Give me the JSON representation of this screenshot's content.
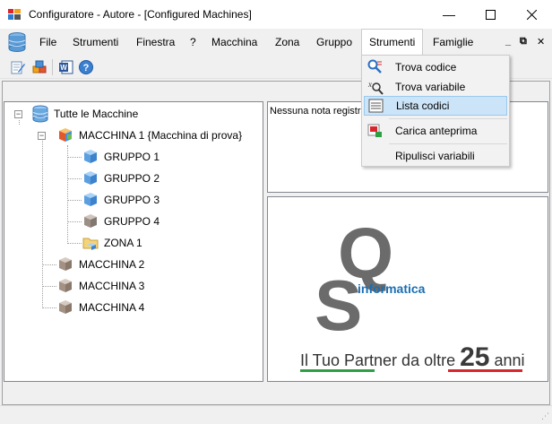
{
  "window": {
    "title": "Configuratore - Autore - [Configured Machines]",
    "controls": [
      "minimize",
      "maximize",
      "close"
    ]
  },
  "menubar": {
    "items": [
      {
        "label": "File"
      },
      {
        "label": "Strumenti"
      },
      {
        "label": "Finestra"
      },
      {
        "label": "?"
      },
      {
        "label": "Macchina"
      },
      {
        "label": "Zona"
      },
      {
        "label": "Gruppo"
      },
      {
        "label": "Strumenti",
        "active": true
      },
      {
        "label": "Famiglie"
      }
    ],
    "mdi_controls": [
      "_",
      "⧉",
      "✕"
    ]
  },
  "toolbar": {
    "icons": [
      "edit-icon",
      "boxes-icon",
      "word-icon",
      "help-icon"
    ]
  },
  "dropdown": {
    "items": [
      {
        "label": "Trova codice",
        "icon": "find-code-icon"
      },
      {
        "label": "Trova variabile",
        "icon": "find-variable-icon"
      },
      {
        "label": "Lista codici",
        "icon": "list-icon",
        "selected": true
      },
      {
        "label": "Carica anteprima",
        "icon": "load-preview-icon"
      },
      {
        "label": "Ripulisci variabili",
        "icon": ""
      }
    ]
  },
  "tree": {
    "root": "Tutte le Macchine",
    "nodes": [
      {
        "label": "MACCHINA 1 {Macchina di prova}",
        "icon": "machine-colored-icon"
      },
      {
        "label": "GRUPPO 1",
        "icon": "group-blue-icon"
      },
      {
        "label": "GRUPPO 2",
        "icon": "group-blue-icon"
      },
      {
        "label": "GRUPPO 3",
        "icon": "group-blue-icon"
      },
      {
        "label": "GRUPPO 4",
        "icon": "group-gray-icon"
      },
      {
        "label": "ZONA 1",
        "icon": "folder-zone-icon"
      },
      {
        "label": "MACCHINA 2",
        "icon": "machine-gray-icon"
      },
      {
        "label": "MACCHINA 3",
        "icon": "machine-gray-icon"
      },
      {
        "label": "MACCHINA 4",
        "icon": "machine-gray-icon"
      }
    ]
  },
  "notes": {
    "text": "Nessuna nota registra… tive alla macchina o al gruppo"
  },
  "logo": {
    "letters": [
      "Q",
      "S"
    ],
    "word": "informatica",
    "tagline_prefix": "Il Tuo Partner da oltre",
    "tagline_number": "25",
    "tagline_suffix": "anni",
    "colors": {
      "green": "#2ea043",
      "white": "#ffffff",
      "red": "#d9262c",
      "blue": "#1a6fb5",
      "gray": "#6b6b6b"
    }
  }
}
